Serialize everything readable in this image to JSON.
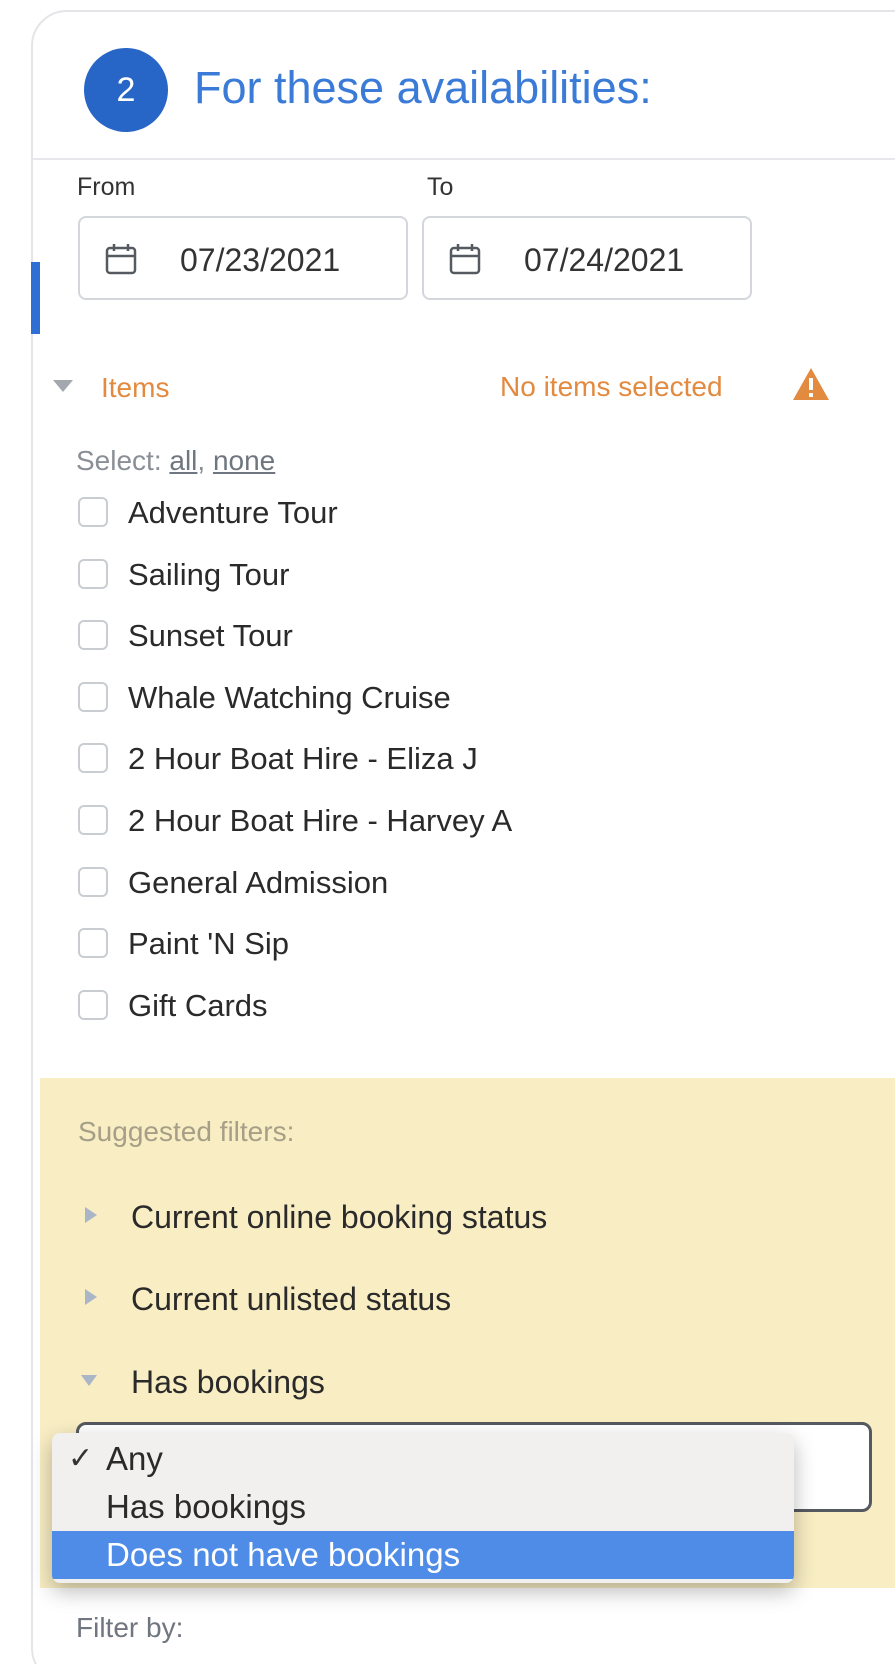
{
  "header": {
    "step_number": "2",
    "title": "For these availabilities:"
  },
  "dates": {
    "from_label": "From",
    "from_value": "07/23/2021",
    "to_label": "To",
    "to_value": "07/24/2021"
  },
  "items_section": {
    "label": "Items",
    "warning": "No items selected",
    "select_prefix": "Select:",
    "select_all": "all",
    "select_none": "none",
    "items": [
      {
        "label": "Adventure Tour",
        "checked": false
      },
      {
        "label": "Sailing Tour",
        "checked": false
      },
      {
        "label": "Sunset Tour",
        "checked": false
      },
      {
        "label": "Whale Watching Cruise",
        "checked": false
      },
      {
        "label": "2 Hour Boat Hire - Eliza J",
        "checked": false
      },
      {
        "label": "2 Hour Boat Hire - Harvey A",
        "checked": false
      },
      {
        "label": "General Admission",
        "checked": false
      },
      {
        "label": "Paint 'N Sip",
        "checked": false
      },
      {
        "label": "Gift Cards",
        "checked": false
      }
    ]
  },
  "suggested_filters": {
    "title": "Suggested filters:",
    "filters": [
      {
        "label": "Current online booking status",
        "expanded": false
      },
      {
        "label": "Current unlisted status",
        "expanded": false
      },
      {
        "label": "Has bookings",
        "expanded": true
      }
    ]
  },
  "has_bookings_dropdown": {
    "options": [
      {
        "label": "Any",
        "checked": true,
        "highlighted": false
      },
      {
        "label": "Has bookings",
        "checked": false,
        "highlighted": false
      },
      {
        "label": "Does not have bookings",
        "checked": false,
        "highlighted": true
      }
    ]
  },
  "footer": {
    "filter_by_label": "Filter by:"
  },
  "colors": {
    "accent_blue": "#2766c6",
    "title_blue": "#3b7bd8",
    "warning_orange": "#e28a3f",
    "suggested_bg": "#f8edc3",
    "highlight_blue": "#4e8ce8"
  }
}
